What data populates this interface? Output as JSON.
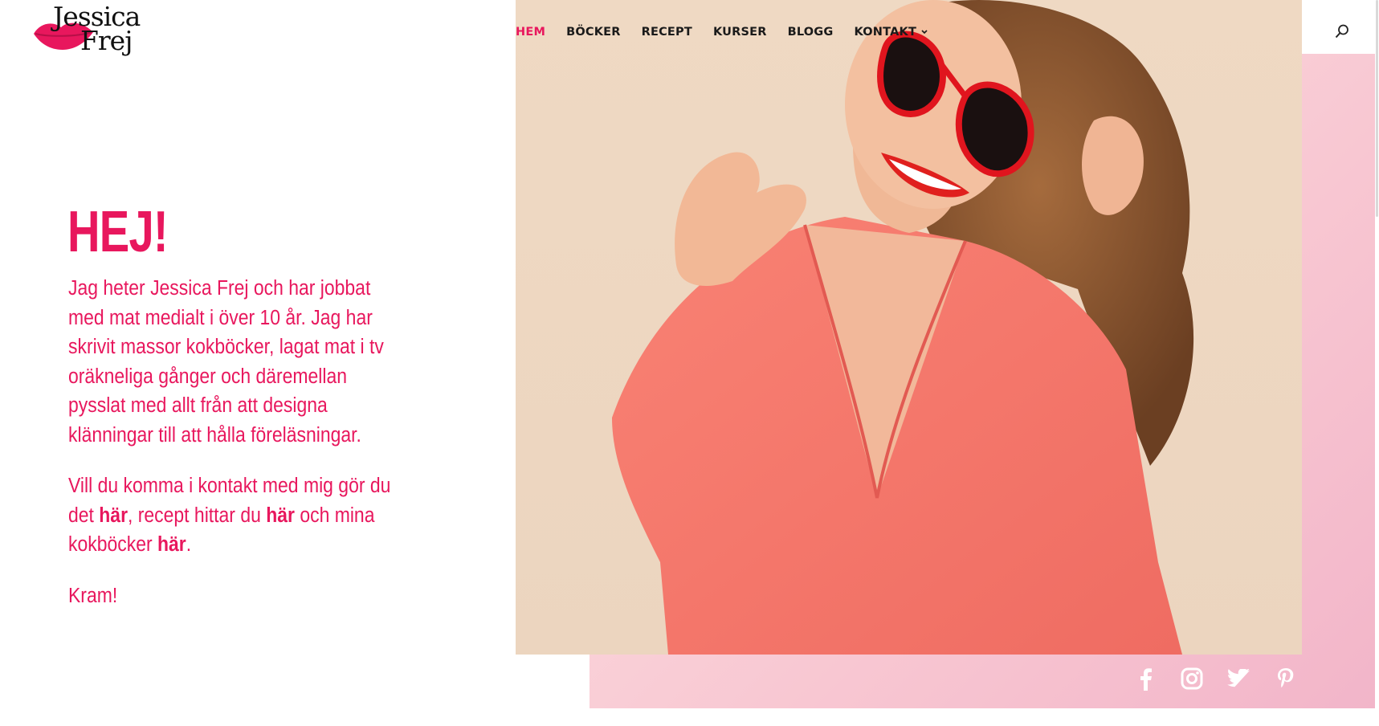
{
  "logo": {
    "line1": "Jessica",
    "line2": "Frej"
  },
  "nav": {
    "items": [
      {
        "label": "HEM"
      },
      {
        "label": "BÖCKER"
      },
      {
        "label": "RECEPT"
      },
      {
        "label": "KURSER"
      },
      {
        "label": "BLOGG"
      },
      {
        "label": "KONTAKT"
      }
    ],
    "kontakt_caret": "›"
  },
  "hero": {
    "heading": "HEJ!",
    "paragraph1": "Jag heter Jessica Frej och har jobbat med mat medialt i över 10 år. Jag har skrivit massor kokböcker, lagat mat i tv oräkneliga gånger och däremellan pysslat med allt från att designa klänningar till att hålla föreläsningar.",
    "p2_a": "Vill du komma i kontakt med mig gör du det ",
    "p2_link1": "här",
    "p2_b": ", recept hittar du ",
    "p2_link2": "här",
    "p2_c": " och mina kokböcker ",
    "p2_link3": "här",
    "p2_d": ".",
    "closing": "Kram!"
  },
  "colors": {
    "accent": "#e8175d",
    "text_dark": "#1a1a1a",
    "panel_pink": "#f8c7d2"
  },
  "social_icons": [
    "facebook-icon",
    "instagram-icon",
    "twitter-icon",
    "pinterest-icon"
  ]
}
